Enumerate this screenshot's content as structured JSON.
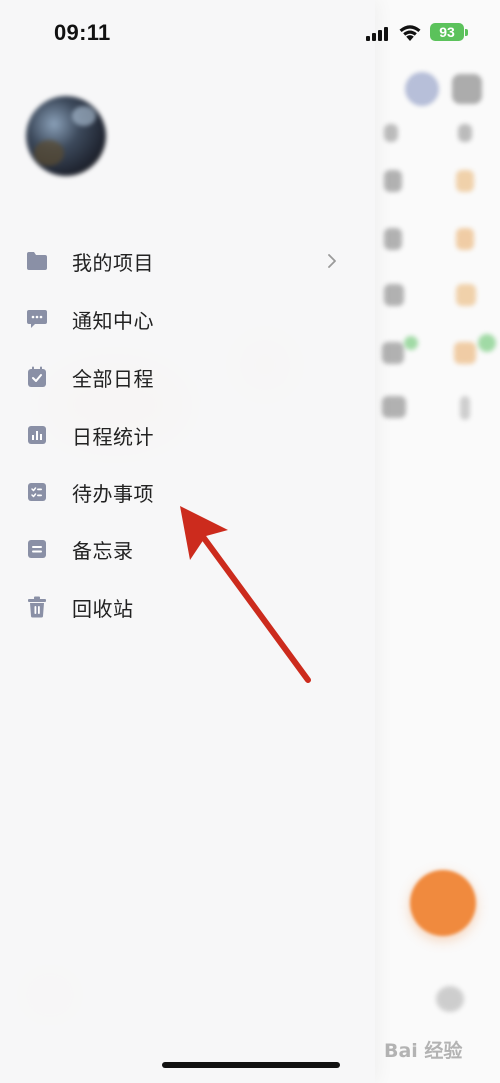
{
  "status_bar": {
    "time": "09:11",
    "battery": "93"
  },
  "drawer": {
    "menu_items": [
      {
        "label": "我的项目",
        "icon": "folder-icon",
        "has_chevron": true
      },
      {
        "label": "通知中心",
        "icon": "message-icon",
        "has_chevron": false
      },
      {
        "label": "全部日程",
        "icon": "calendar-check-icon",
        "has_chevron": false
      },
      {
        "label": "日程统计",
        "icon": "bar-chart-icon",
        "has_chevron": false
      },
      {
        "label": "待办事项",
        "icon": "todo-list-icon",
        "has_chevron": false
      },
      {
        "label": "备忘录",
        "icon": "memo-icon",
        "has_chevron": false
      },
      {
        "label": "回收站",
        "icon": "trash-icon",
        "has_chevron": false
      }
    ]
  },
  "annotation": {
    "type": "red-arrow",
    "points_to": "待办事项",
    "color": "#cc2b1d"
  },
  "watermark": {
    "text": "Bai 经验"
  },
  "colors": {
    "icon_gray": "#8a90a6",
    "fab_orange": "#f08a3e",
    "battery_green": "#5bc25b"
  }
}
